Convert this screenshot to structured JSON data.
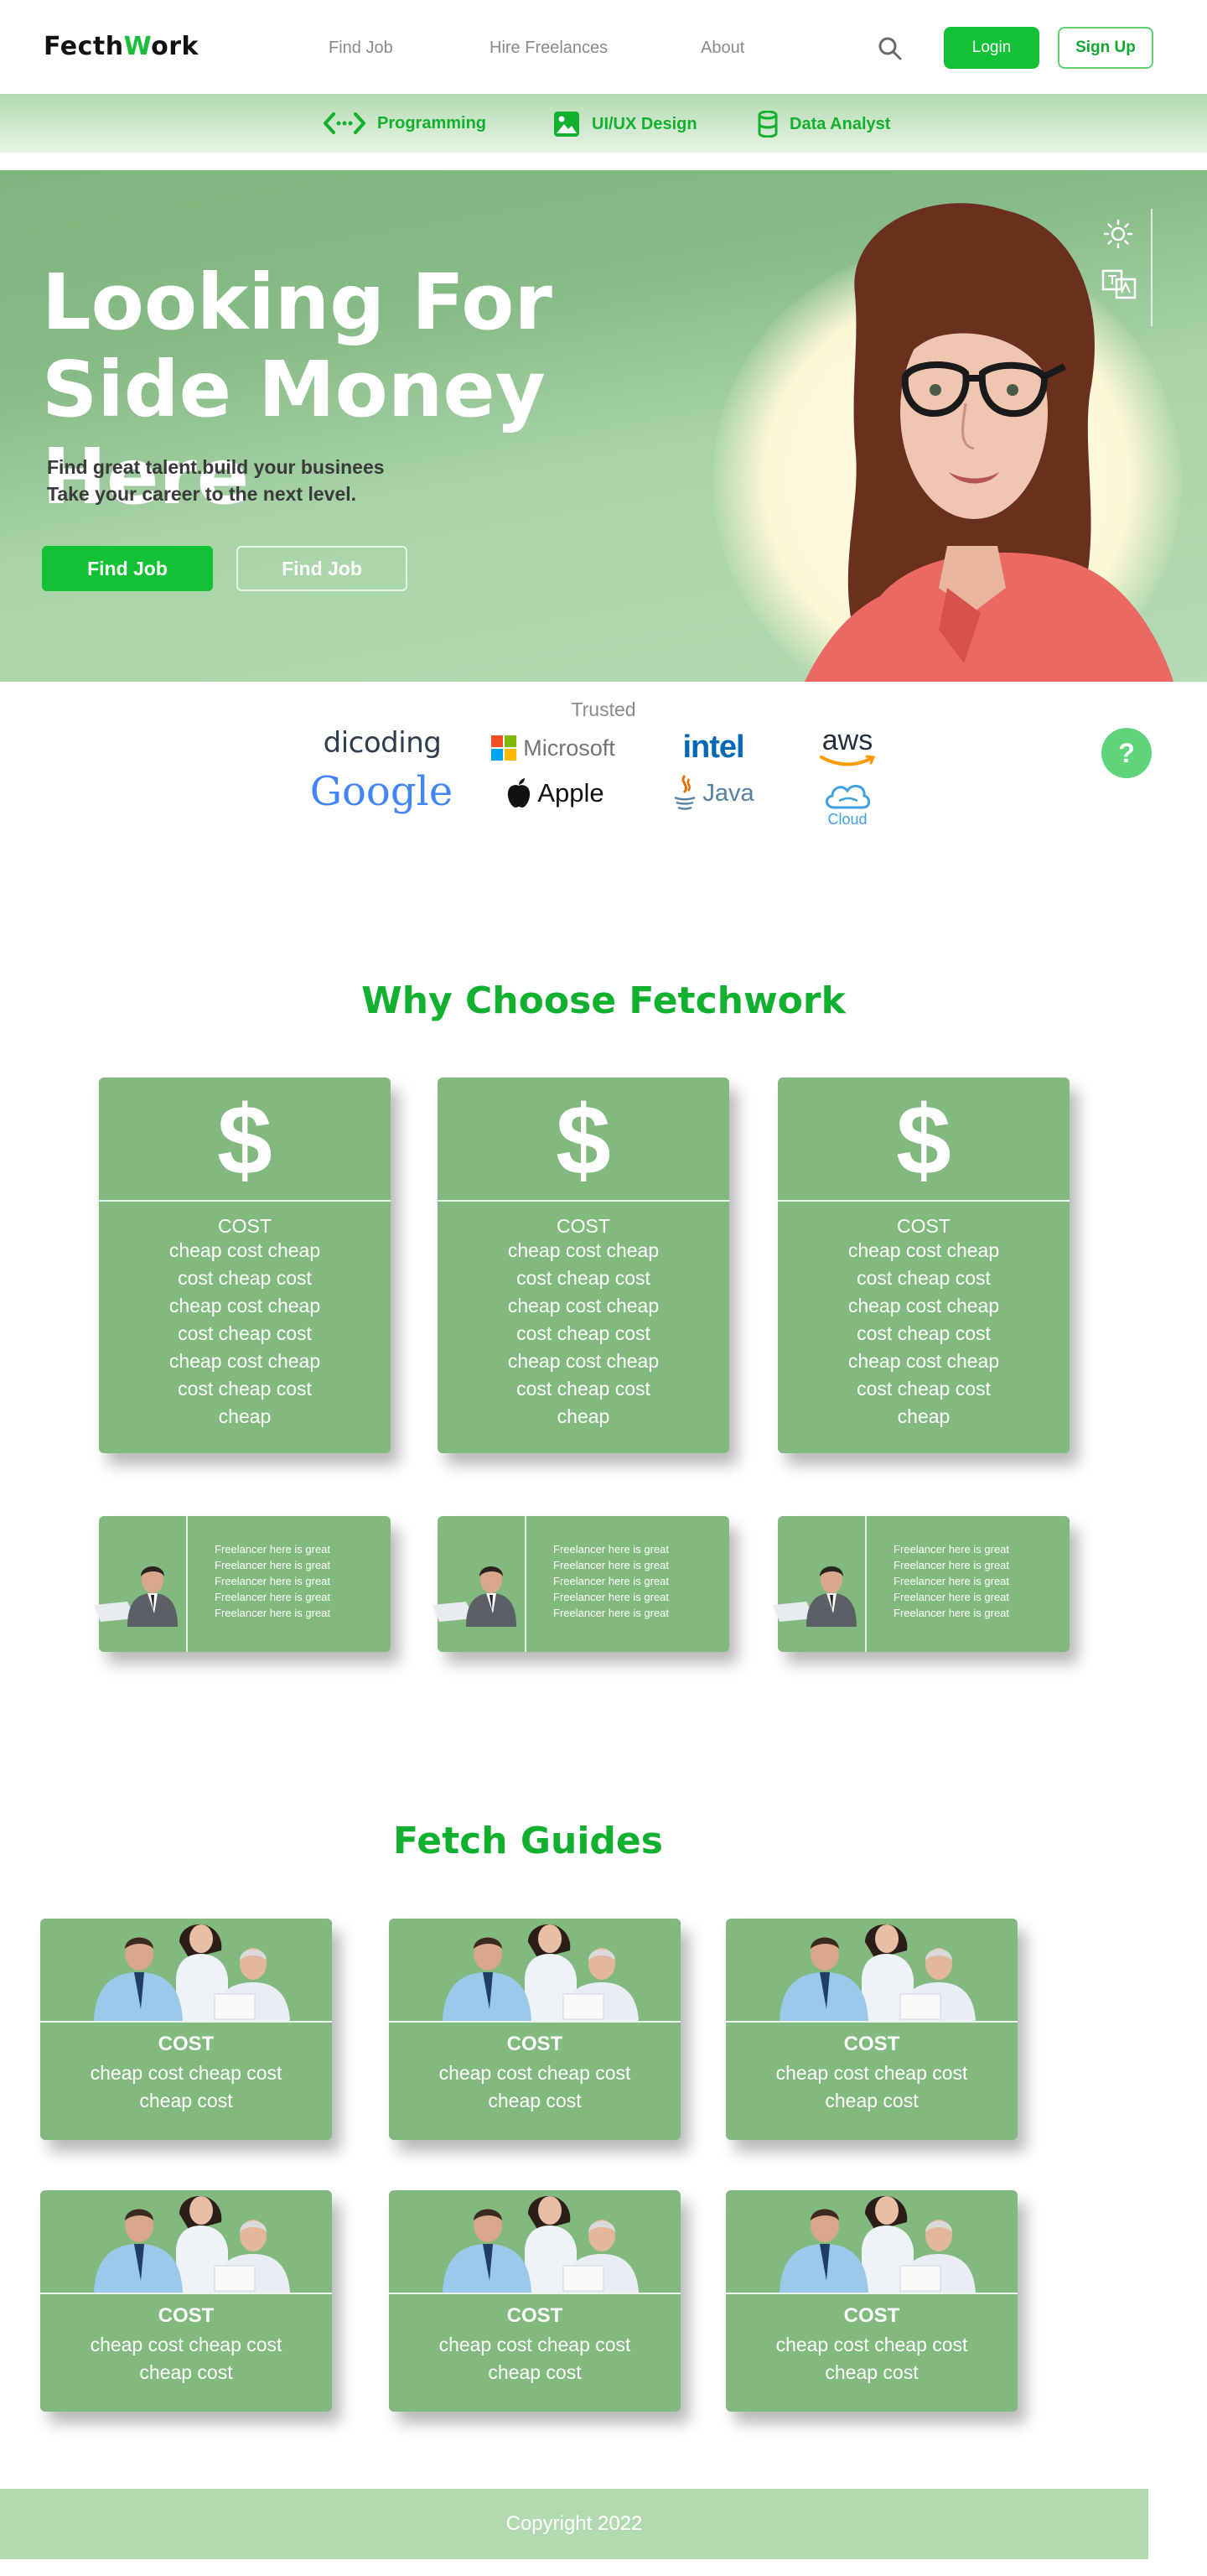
{
  "header": {
    "logo_main": "Fecth",
    "logo_accent": "W",
    "logo_rest": "ork",
    "nav": [
      "Find Job",
      "Hire Freelances",
      "About"
    ],
    "login_label": "Login",
    "signup_label": "Sign Up"
  },
  "categories": [
    {
      "label": "Programming",
      "icon": "code-icon"
    },
    {
      "label": "UI/UX Design",
      "icon": "image-icon"
    },
    {
      "label": "Data Analyst",
      "icon": "database-icon"
    }
  ],
  "hero": {
    "title": "Looking For Side Money Here",
    "subtitle_line1": "Find great talent.build your businees",
    "subtitle_line2": "Take your career to the next level.",
    "primary_button": "Find Job",
    "secondary_button": "Find Job"
  },
  "trusted": {
    "label": "Trusted",
    "brands": [
      "dicoding",
      "Microsoft",
      "intel",
      "aws",
      "Google",
      "Apple",
      "Java",
      "Cloud"
    ]
  },
  "help_label": "?",
  "why": {
    "title": "Why Choose Fetchwork",
    "cards": [
      {
        "symbol": "$",
        "title": "COST",
        "text": "cheap cost cheap cost cheap cost cheap cost cheap cost cheap cost cheap cost cheap cost cheap cost cheap"
      },
      {
        "symbol": "$",
        "title": "COST",
        "text": "cheap cost cheap cost cheap cost cheap cost cheap cost cheap cost cheap cost cheap cost cheap cost cheap"
      },
      {
        "symbol": "$",
        "title": "COST",
        "text": "cheap cost cheap cost cheap cost cheap cost cheap cost cheap cost cheap cost cheap cost cheap cost cheap"
      }
    ],
    "freelancers": [
      {
        "lines": [
          "Freelancer here is great",
          "Freelancer here is great",
          "Freelancer here is great",
          "Freelancer here is great",
          "Freelancer here is great"
        ]
      },
      {
        "lines": [
          "Freelancer here is great",
          "Freelancer here is great",
          "Freelancer here is great",
          "Freelancer here is great",
          "Freelancer here is great"
        ]
      },
      {
        "lines": [
          "Freelancer here is great",
          "Freelancer here is great",
          "Freelancer here is great",
          "Freelancer here is great",
          "Freelancer here is great"
        ]
      }
    ]
  },
  "guides": {
    "title": "Fetch Guides",
    "cards": [
      {
        "title": "COST",
        "text": "cheap cost cheap cost cheap cost"
      },
      {
        "title": "COST",
        "text": "cheap cost cheap cost cheap cost"
      },
      {
        "title": "COST",
        "text": "cheap cost cheap cost cheap cost"
      },
      {
        "title": "COST",
        "text": "cheap cost cheap cost cheap cost"
      },
      {
        "title": "COST",
        "text": "cheap cost cheap cost cheap cost"
      },
      {
        "title": "COST",
        "text": "cheap cost cheap cost cheap cost"
      }
    ]
  },
  "footer": {
    "copyright": "Copyright 2022"
  },
  "colors": {
    "brand": "#12c234",
    "card": "#82b97e",
    "hero": "#87bb86",
    "footer": "#b2d9b0"
  }
}
